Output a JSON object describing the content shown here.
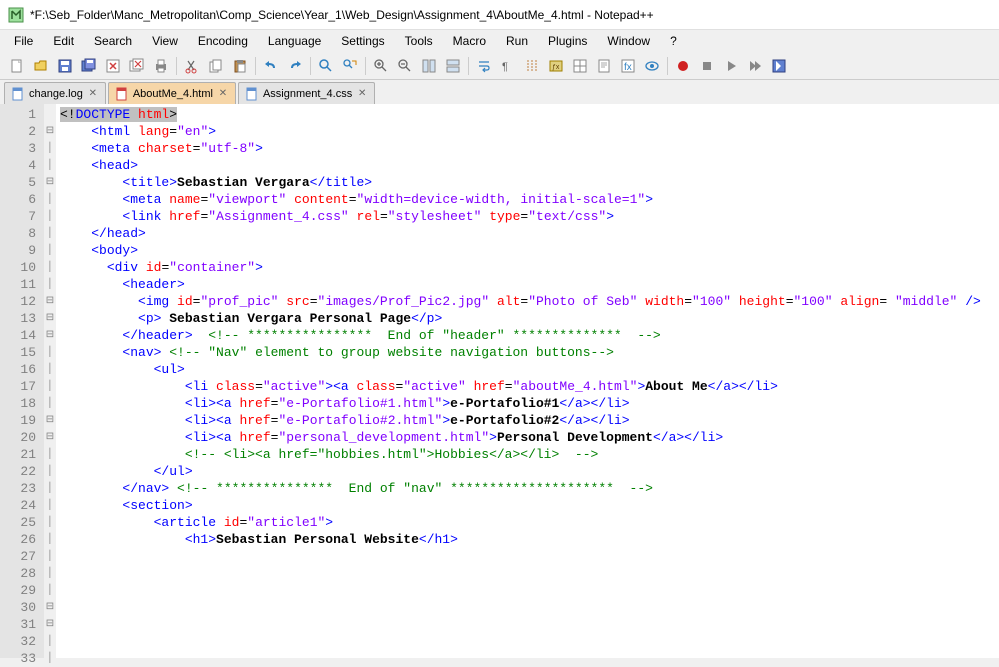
{
  "window": {
    "title": "*F:\\Seb_Folder\\Manc_Metropolitan\\Comp_Science\\Year_1\\Web_Design\\Assignment_4\\AboutMe_4.html - Notepad++"
  },
  "menu": {
    "file": "File",
    "edit": "Edit",
    "search": "Search",
    "view": "View",
    "encoding": "Encoding",
    "language": "Language",
    "settings": "Settings",
    "tools": "Tools",
    "macro": "Macro",
    "run": "Run",
    "plugins": "Plugins",
    "window": "Window",
    "help": "?"
  },
  "tabs": [
    {
      "label": "change.log"
    },
    {
      "label": "AboutMe_4.html"
    },
    {
      "label": "Assignment_4.css"
    }
  ],
  "code": {
    "lines": [
      {
        "n": "1",
        "fold": "",
        "html": "<span class='hl-sel'>&lt;!</span><span class='t-tag hl-sel'>DOCTYPE</span><span class='hl-sel'> </span><span class='t-attr hl-sel'>html</span><span class='hl-sel'>&gt;</span>"
      },
      {
        "n": "2",
        "fold": "⊟",
        "html": "    <span class='t-tag'>&lt;html</span> <span class='t-attr'>lang</span>=<span class='t-str'>\"en\"</span><span class='t-tag'>&gt;</span>"
      },
      {
        "n": "3",
        "fold": "│",
        "html": "    <span class='t-tag'>&lt;meta</span> <span class='t-attr'>charset</span>=<span class='t-str'>\"utf-8\"</span><span class='t-tag'>&gt;</span>"
      },
      {
        "n": "4",
        "fold": "│",
        "html": ""
      },
      {
        "n": "5",
        "fold": "⊟",
        "html": "    <span class='t-tag'>&lt;head&gt;</span>"
      },
      {
        "n": "6",
        "fold": "│",
        "html": ""
      },
      {
        "n": "7",
        "fold": "│",
        "html": "        <span class='t-tag'>&lt;title&gt;</span><span class='t-txt'>Sebastian Vergara</span><span class='t-tag'>&lt;/title&gt;</span>"
      },
      {
        "n": "8",
        "fold": "│",
        "html": "        <span class='t-tag'>&lt;meta</span> <span class='t-attr'>name</span>=<span class='t-str'>\"viewport\"</span> <span class='t-attr'>content</span>=<span class='t-str'>\"width=device-width, initial-scale=1\"</span><span class='t-tag'>&gt;</span>"
      },
      {
        "n": "9",
        "fold": "│",
        "html": "        <span class='t-tag'>&lt;link</span> <span class='t-attr'>href</span>=<span class='t-str'>\"Assignment_4.css\"</span> <span class='t-attr'>rel</span>=<span class='t-str'>\"stylesheet\"</span> <span class='t-attr'>type</span>=<span class='t-str'>\"text/css\"</span><span class='t-tag'>&gt;</span>"
      },
      {
        "n": "10",
        "fold": "│",
        "html": "    <span class='t-tag'>&lt;/head&gt;</span>"
      },
      {
        "n": "11",
        "fold": "│",
        "html": ""
      },
      {
        "n": "12",
        "fold": "⊟",
        "html": "    <span class='t-tag'>&lt;body&gt;</span>"
      },
      {
        "n": "13",
        "fold": "⊟",
        "html": "      <span class='t-tag'>&lt;div</span> <span class='t-attr'>id</span>=<span class='t-str'>\"container\"</span><span class='t-tag'>&gt;</span>"
      },
      {
        "n": "14",
        "fold": "⊟",
        "html": "        <span class='t-tag'>&lt;header&gt;</span>"
      },
      {
        "n": "15",
        "fold": "│",
        "html": "          <span class='t-tag'>&lt;img</span> <span class='t-attr'>id</span>=<span class='t-str'>\"prof_pic\"</span> <span class='t-attr'>src</span>=<span class='t-str'>\"images/Prof_Pic2.jpg\"</span> <span class='t-attr'>alt</span>=<span class='t-str'>\"Photo of Seb\"</span> <span class='t-attr'>width</span>=<span class='t-str'>\"100\"</span> <span class='t-attr'>height</span>=<span class='t-str'>\"100\"</span> <span class='t-attr'>align</span>= <span class='t-str'>\"middle\"</span> <span class='t-tag'>/&gt;</span>"
      },
      {
        "n": "16",
        "fold": "│",
        "html": "          <span class='t-tag'>&lt;p&gt;</span><span class='t-txt'> Sebastian Vergara Personal Page</span><span class='t-tag'>&lt;/p&gt;</span>"
      },
      {
        "n": "17",
        "fold": "│",
        "html": "        <span class='t-tag'>&lt;/header&gt;</span>  <span class='t-com'>&lt;!-- ****************  End of \"header\" **************  --&gt;</span>"
      },
      {
        "n": "18",
        "fold": "│",
        "html": ""
      },
      {
        "n": "19",
        "fold": "⊟",
        "html": "        <span class='t-tag'>&lt;nav&gt;</span> <span class='t-com'>&lt;!-- \"Nav\" element to group website navigation buttons--&gt;</span>"
      },
      {
        "n": "20",
        "fold": "⊟",
        "html": "            <span class='t-tag'>&lt;ul&gt;</span>"
      },
      {
        "n": "21",
        "fold": "│",
        "html": "                <span class='t-tag'>&lt;li</span> <span class='t-attr'>class</span>=<span class='t-str'>\"active\"</span><span class='t-tag'>&gt;&lt;a</span> <span class='t-attr'>class</span>=<span class='t-str'>\"active\"</span> <span class='t-attr'>href</span>=<span class='t-str'>\"aboutMe_4.html\"</span><span class='t-tag'>&gt;</span><span class='t-txt'>About Me</span><span class='t-tag'>&lt;/a&gt;&lt;/li&gt;</span>"
      },
      {
        "n": "22",
        "fold": "│",
        "html": "                <span class='t-tag'>&lt;li&gt;&lt;a</span> <span class='t-attr'>href</span>=<span class='t-str'>\"e-Portafolio#1.html\"</span><span class='t-tag'>&gt;</span><span class='t-txt'>e-Portafolio#1</span><span class='t-tag'>&lt;/a&gt;&lt;/li&gt;</span>"
      },
      {
        "n": "23",
        "fold": "│",
        "html": "                <span class='t-tag'>&lt;li&gt;&lt;a</span> <span class='t-attr'>href</span>=<span class='t-str'>\"e-Portafolio#2.html\"</span><span class='t-tag'>&gt;</span><span class='t-txt'>e-Portafolio#2</span><span class='t-tag'>&lt;/a&gt;&lt;/li&gt;</span>"
      },
      {
        "n": "24",
        "fold": "│",
        "html": "                <span class='t-tag'>&lt;li&gt;&lt;a</span> <span class='t-attr'>href</span>=<span class='t-str'>\"personal_development.html\"</span><span class='t-tag'>&gt;</span><span class='t-txt'>Personal Development</span><span class='t-tag'>&lt;/a&gt;&lt;/li&gt;</span>"
      },
      {
        "n": "25",
        "fold": "│",
        "html": "                <span class='t-com'>&lt;!-- &lt;li&gt;&lt;a href=\"hobbies.html\"&gt;Hobbies&lt;/a&gt;&lt;/li&gt;  --&gt;</span>"
      },
      {
        "n": "26",
        "fold": "│",
        "html": "            <span class='t-tag'>&lt;/ul&gt;</span>"
      },
      {
        "n": "27",
        "fold": "│",
        "html": ""
      },
      {
        "n": "28",
        "fold": "│",
        "html": "        <span class='t-tag'>&lt;/nav&gt;</span> <span class='t-com'>&lt;!-- ***************  End of \"nav\" *********************  --&gt;</span>"
      },
      {
        "n": "29",
        "fold": "│",
        "html": ""
      },
      {
        "n": "30",
        "fold": "⊟",
        "html": "        <span class='t-tag'>&lt;section&gt;</span>"
      },
      {
        "n": "31",
        "fold": "⊟",
        "html": "            <span class='t-tag'>&lt;article</span> <span class='t-attr'>id</span>=<span class='t-str'>\"article1\"</span><span class='t-tag'>&gt;</span>"
      },
      {
        "n": "32",
        "fold": "│",
        "html": "                <span class='t-tag'>&lt;h1&gt;</span><span class='t-txt'>Sebastian Personal Website</span><span class='t-tag'>&lt;/h1&gt;</span>"
      },
      {
        "n": "33",
        "fold": "│",
        "html": ""
      }
    ]
  }
}
